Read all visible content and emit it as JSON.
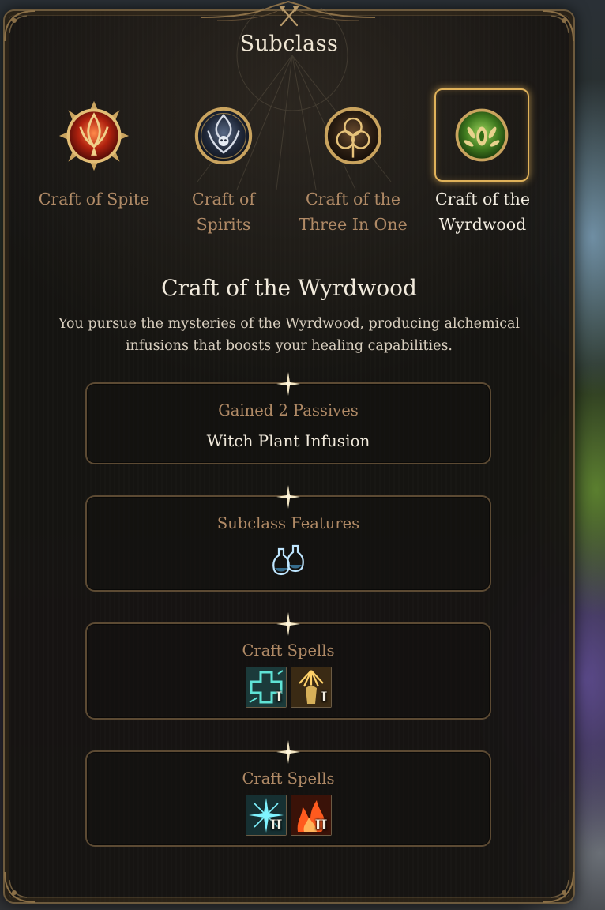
{
  "header": {
    "title": "Subclass",
    "icon": "crossed-axes-icon"
  },
  "subclasses": [
    {
      "label": "Craft of Spite",
      "icon": "spite-emblem-icon",
      "selected": false
    },
    {
      "label": "Craft of Spirits",
      "icon": "spirits-emblem-icon",
      "selected": false
    },
    {
      "label": "Craft of the Three In One",
      "icon": "three-in-one-emblem-icon",
      "selected": false
    },
    {
      "label": "Craft of the Wyrdwood",
      "icon": "wyrdwood-emblem-icon",
      "selected": true
    }
  ],
  "detail": {
    "title": "Craft of the Wyrdwood",
    "description": "You pursue the mysteries of the Wyrdwood, producing alchemical infusions that boosts your healing capabilities."
  },
  "sections": [
    {
      "heading": "Gained 2 Passives",
      "value": "Witch Plant Infusion"
    },
    {
      "heading": "Subclass Features",
      "icon": "potion-bottles-icon"
    },
    {
      "heading": "Craft Spells",
      "spells": [
        {
          "icon": "teal-cross-spell-icon",
          "level": "I"
        },
        {
          "icon": "golden-radiance-spell-icon",
          "level": "I"
        }
      ]
    },
    {
      "heading": "Craft Spells",
      "spells": [
        {
          "icon": "cyan-starburst-spell-icon",
          "level": "II"
        },
        {
          "icon": "flame-spell-icon",
          "level": "II"
        }
      ]
    }
  ],
  "colors": {
    "accent_gold": "#e0b25a",
    "label_muted": "#b08a66",
    "text_light": "#f1eadc",
    "frame": "#6d5a3d"
  }
}
